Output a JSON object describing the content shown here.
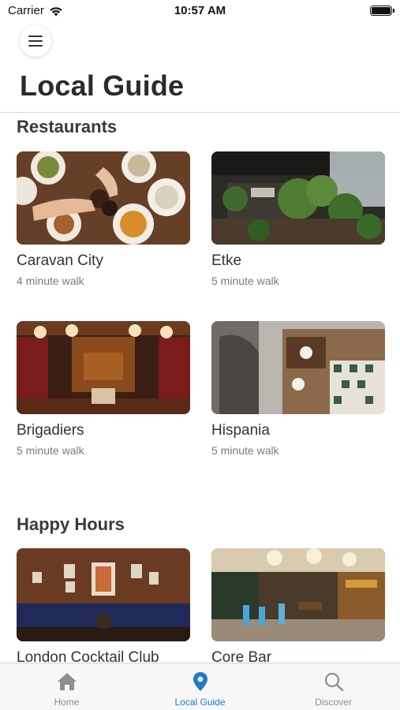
{
  "status_bar": {
    "carrier": "Carrier",
    "time": "10:57 AM"
  },
  "header": {
    "menu_icon": "hamburger-menu-icon",
    "title": "Local Guide"
  },
  "sections": [
    {
      "title": "Restaurants",
      "items": [
        {
          "name": "Caravan City",
          "subtitle": "4 minute walk"
        },
        {
          "name": "Etke",
          "subtitle": "5 minute walk"
        },
        {
          "name": "Brigadiers",
          "subtitle": "5 minute walk"
        },
        {
          "name": "Hispania",
          "subtitle": "5 minute walk"
        }
      ]
    },
    {
      "title": "Happy Hours",
      "items": [
        {
          "name": "London Cocktail Club",
          "subtitle": ""
        },
        {
          "name": "Core Bar",
          "subtitle": ""
        }
      ]
    }
  ],
  "tab_bar": {
    "tabs": [
      {
        "label": "Home",
        "icon": "home-icon",
        "active": false
      },
      {
        "label": "Local Guide",
        "icon": "location-pin-icon",
        "active": true
      },
      {
        "label": "Discover",
        "icon": "search-icon",
        "active": false
      }
    ]
  },
  "colors": {
    "accent": "#1f7ac9",
    "inactive": "#8e8e8e",
    "title_text": "#2b2b2b"
  }
}
